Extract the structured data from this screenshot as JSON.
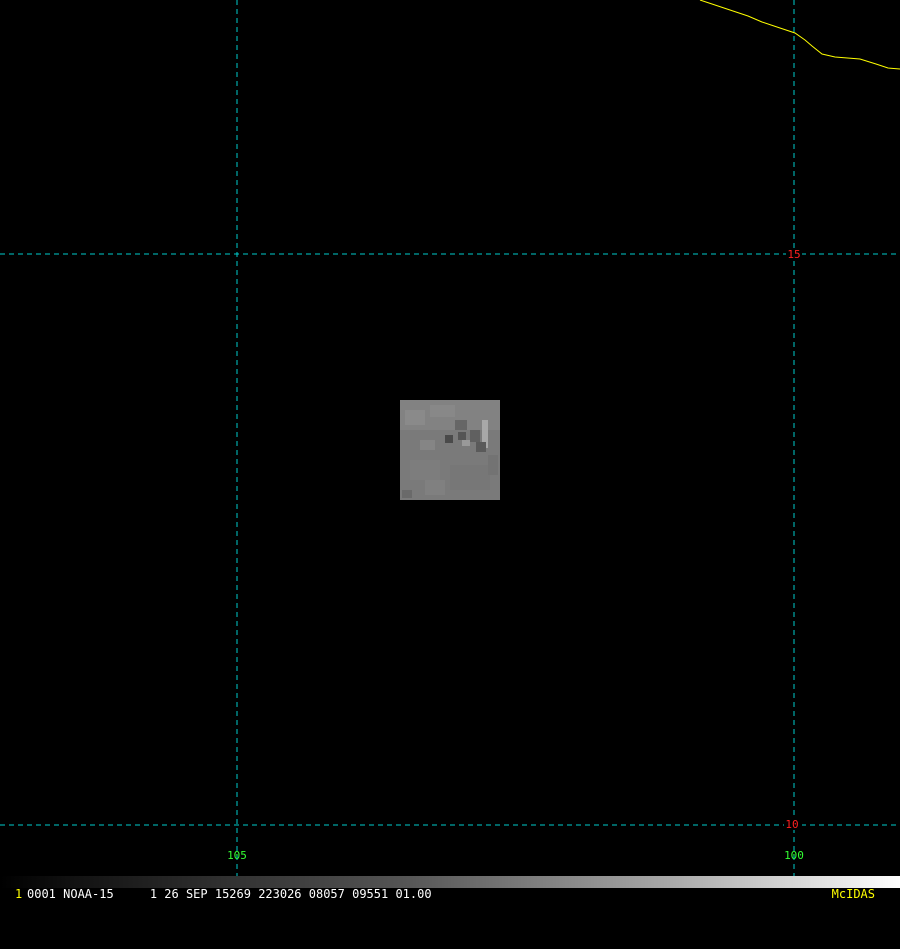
{
  "map": {
    "background": "#000000",
    "grid_color": "#00cccc",
    "coast_color": "#ffff00",
    "lat_label_color": "#ff2020",
    "lon_label_color": "#33ff33",
    "longitude_lines": [
      {
        "label": "105"
      },
      {
        "label": "100"
      }
    ],
    "latitude_lines": [
      {
        "label": "15"
      },
      {
        "label": "10"
      }
    ]
  },
  "status_bar": {
    "frame_number": "1",
    "info": "0001 NOAA-15     1 26 SEP 15269 223026 08057 09551 01.00",
    "brand": "McIDAS"
  }
}
